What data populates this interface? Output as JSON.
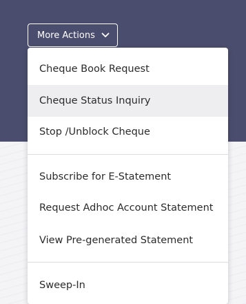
{
  "more_actions": {
    "label": "More Actions",
    "icon": "chevron-down-icon"
  },
  "menu": {
    "items": [
      {
        "label": "Cheque Book Request"
      },
      {
        "label": "Cheque Status Inquiry"
      },
      {
        "label": "Stop /Unblock Cheque"
      },
      {
        "label": "Subscribe for E-Statement"
      },
      {
        "label": "Request Adhoc Account Statement"
      },
      {
        "label": "View Pre-generated Statement"
      },
      {
        "label": "Sweep-In"
      }
    ]
  },
  "colors": {
    "header_band": "#4b4d6e",
    "highlight": "#eeeef0",
    "text": "#2b2b2b"
  }
}
